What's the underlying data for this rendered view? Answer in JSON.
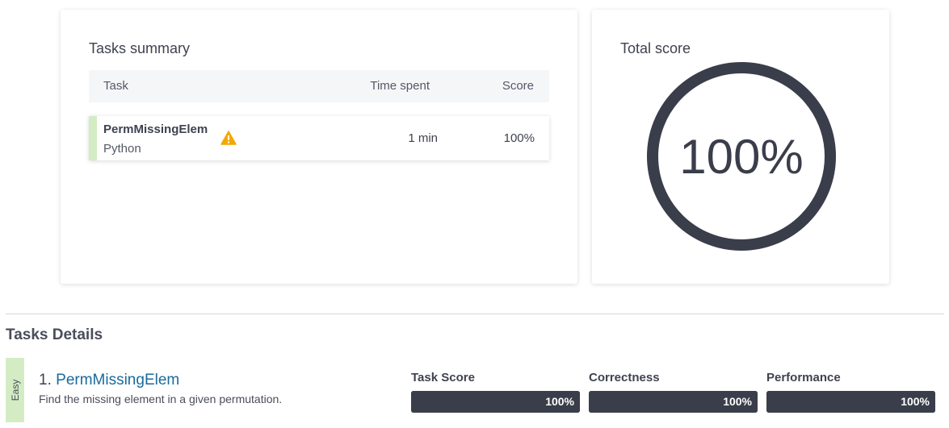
{
  "summary": {
    "title": "Tasks summary",
    "headers": {
      "task": "Task",
      "time": "Time spent",
      "score": "Score"
    },
    "rows": [
      {
        "name": "PermMissingElem",
        "language": "Python",
        "warning_icon": "warning-icon",
        "time": "1 min",
        "score": "100%"
      }
    ]
  },
  "total": {
    "title": "Total score",
    "value": "100%",
    "fraction": 1.0
  },
  "details": {
    "title": "Tasks Details",
    "tasks": [
      {
        "difficulty": "Easy",
        "number": "1.",
        "name": "PermMissingElem",
        "description": "Find the missing element in a given permutation.",
        "metrics": [
          {
            "label": "Task Score",
            "value": "100%",
            "fraction": 1.0
          },
          {
            "label": "Correctness",
            "value": "100%",
            "fraction": 1.0
          },
          {
            "label": "Performance",
            "value": "100%",
            "fraction": 1.0
          }
        ]
      }
    ]
  },
  "colors": {
    "dark": "#3a3d4a",
    "easy_green": "#d4ecc4",
    "link_blue": "#1a6a9c",
    "warning_orange": "#f2a900"
  }
}
